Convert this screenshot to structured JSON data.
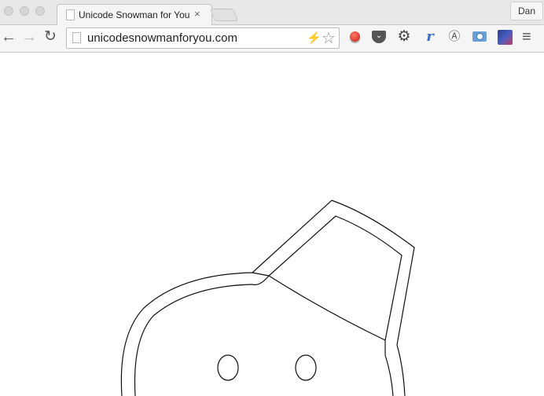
{
  "browser": {
    "tab": {
      "title": "Unicode Snowman for You",
      "close_glyph": "×"
    },
    "profile_button": "Dan",
    "omnibox": {
      "url": "unicodesnowmanforyou.com"
    },
    "nav": {
      "back_glyph": "←",
      "forward_glyph": "→",
      "reload_glyph": "↻"
    },
    "toolbar_icons": {
      "bolt": "⚡",
      "star": "☆",
      "gear": "⚙",
      "r": "r",
      "a": "Ⓐ",
      "menu": "≡"
    }
  },
  "page": {
    "content": "snowman outline"
  }
}
